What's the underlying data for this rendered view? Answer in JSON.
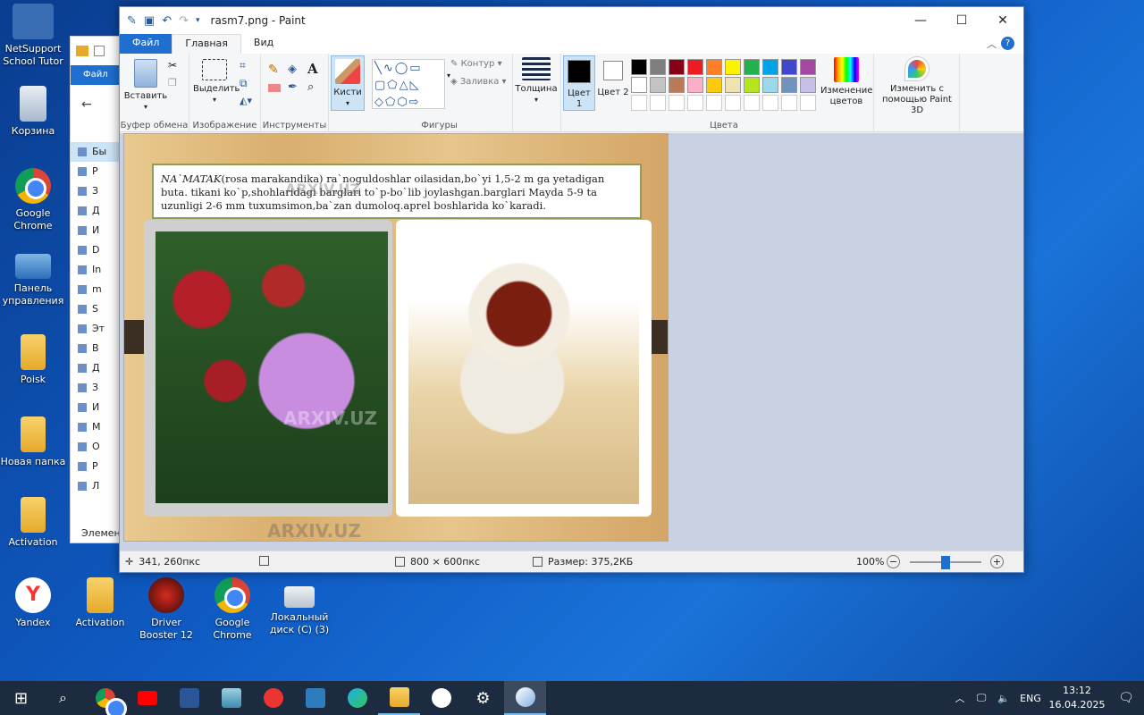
{
  "desktop": {
    "icons": [
      {
        "label": "NetSupport School Tutor",
        "icon": "netsupport-icon"
      },
      {
        "label": "Корзина",
        "icon": "recycle-bin-icon"
      },
      {
        "label": "Google Chrome",
        "icon": "chrome-icon"
      },
      {
        "label": "Панель управления",
        "icon": "control-panel-icon"
      },
      {
        "label": "Poisk",
        "icon": "folder-icon"
      },
      {
        "label": "Новая папка",
        "icon": "folder-icon"
      },
      {
        "label": "Activation",
        "icon": "folder-icon"
      },
      {
        "label": "Yandex",
        "icon": "yandex-icon"
      },
      {
        "label": "Activation",
        "icon": "folder-icon"
      },
      {
        "label": "Driver Booster 12",
        "icon": "driver-booster-icon"
      },
      {
        "label": "Google Chrome",
        "icon": "chrome-icon"
      },
      {
        "label": "Локальный диск (C) (3)",
        "icon": "drive-icon"
      }
    ]
  },
  "explorer": {
    "tab": "Файл",
    "rows": [
      "Бы",
      "Р",
      "З",
      "Д",
      "И",
      "D",
      "In",
      "m",
      "S",
      "Эт",
      "В",
      "Д",
      "З",
      "И",
      "М",
      "О",
      "Р",
      "Л"
    ],
    "footer": "Элемент"
  },
  "paint": {
    "title": "rasm7.png - Paint",
    "tabs": {
      "file": "Файл",
      "home": "Главная",
      "view": "Вид"
    },
    "ribbon": {
      "clipboard": {
        "paste": "Вставить",
        "group": "Буфер обмена"
      },
      "image": {
        "select": "Выделить",
        "group": "Изображение"
      },
      "tools": {
        "group": "Инструменты"
      },
      "brushes": {
        "label": "Кисти"
      },
      "shapes": {
        "outline": "Контур",
        "fill": "Заливка",
        "group": "Фигуры"
      },
      "size": {
        "label": "Толщина"
      },
      "color1": {
        "label": "Цвет 1"
      },
      "color2": {
        "label": "Цвет 2"
      },
      "colors_group": "Цвета",
      "edit_colors": "Изменение цветов",
      "paint3d": "Изменить с помощью Paint 3D",
      "palette": [
        "#000000",
        "#7f7f7f",
        "#880015",
        "#ed1c24",
        "#ff7f27",
        "#fff200",
        "#22b14c",
        "#00a2e8",
        "#3f48cc",
        "#a349a4",
        "#ffffff",
        "#c3c3c3",
        "#b97a57",
        "#ffaec9",
        "#ffc90e",
        "#efe4b0",
        "#b5e61d",
        "#99d9ea",
        "#7092be",
        "#c8bfe7"
      ]
    },
    "canvas": {
      "text_title": "NA`MATAK",
      "text_body": "(rosa marakandika) ra`noguldoshlar oilasidan,bo`yi 1,5-2 m ga yetadigan buta.  tikani ko`p,shohlaridagi barglari to`p-bo`lib joylashgan.barglari Mayda 5-9 ta uzunligi 2-6 mm tuxumsimon,ba`zan dumoloq.aprel boshlarida ko`karadi.",
      "watermark": "ARXIV.UZ"
    },
    "status": {
      "cursor": "341, 260пкс",
      "dimensions": "800 × 600пкс",
      "size": "Размер: 375,2КБ",
      "zoom": "100%",
      "zoom_level": 0.5
    }
  },
  "taskbar": {
    "language": "ENG",
    "time": "13:12",
    "date": "16.04.2025"
  }
}
